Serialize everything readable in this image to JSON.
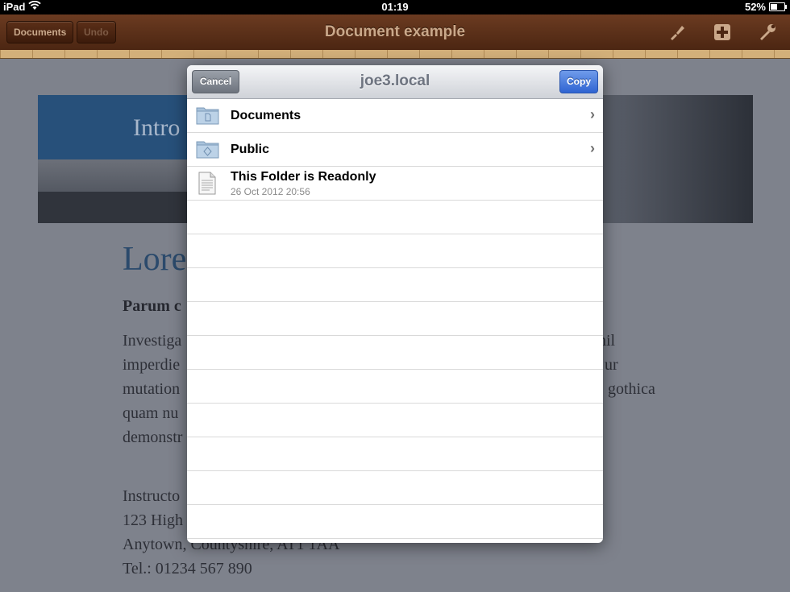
{
  "status_bar": {
    "device": "iPad",
    "time": "01:19",
    "battery": "52%",
    "battery_fill": 0.52
  },
  "toolbar": {
    "title": "Document example",
    "documents_label": "Documents",
    "undo_label": "Undo"
  },
  "document": {
    "banner_text": "Intro",
    "heading": "Lore",
    "subheading": "Parum c",
    "para_left": [
      "Investiga",
      "imperdie",
      "mutation",
      "quam nu",
      "demonstr"
    ],
    "para_right": [
      "hil",
      "ur",
      "gothica"
    ],
    "address": [
      "Instructo",
      "123 High",
      "Anytown, Countyshire, AT1 1AA",
      "Tel.: 01234 567 890"
    ]
  },
  "modal": {
    "title": "joe3.local",
    "cancel_label": "Cancel",
    "copy_label": "Copy",
    "items": [
      {
        "name": "Documents",
        "type": "folder"
      },
      {
        "name": "Public",
        "type": "folder"
      },
      {
        "name": "This Folder is Readonly",
        "type": "file",
        "date": "26 Oct 2012 20:56"
      }
    ]
  }
}
